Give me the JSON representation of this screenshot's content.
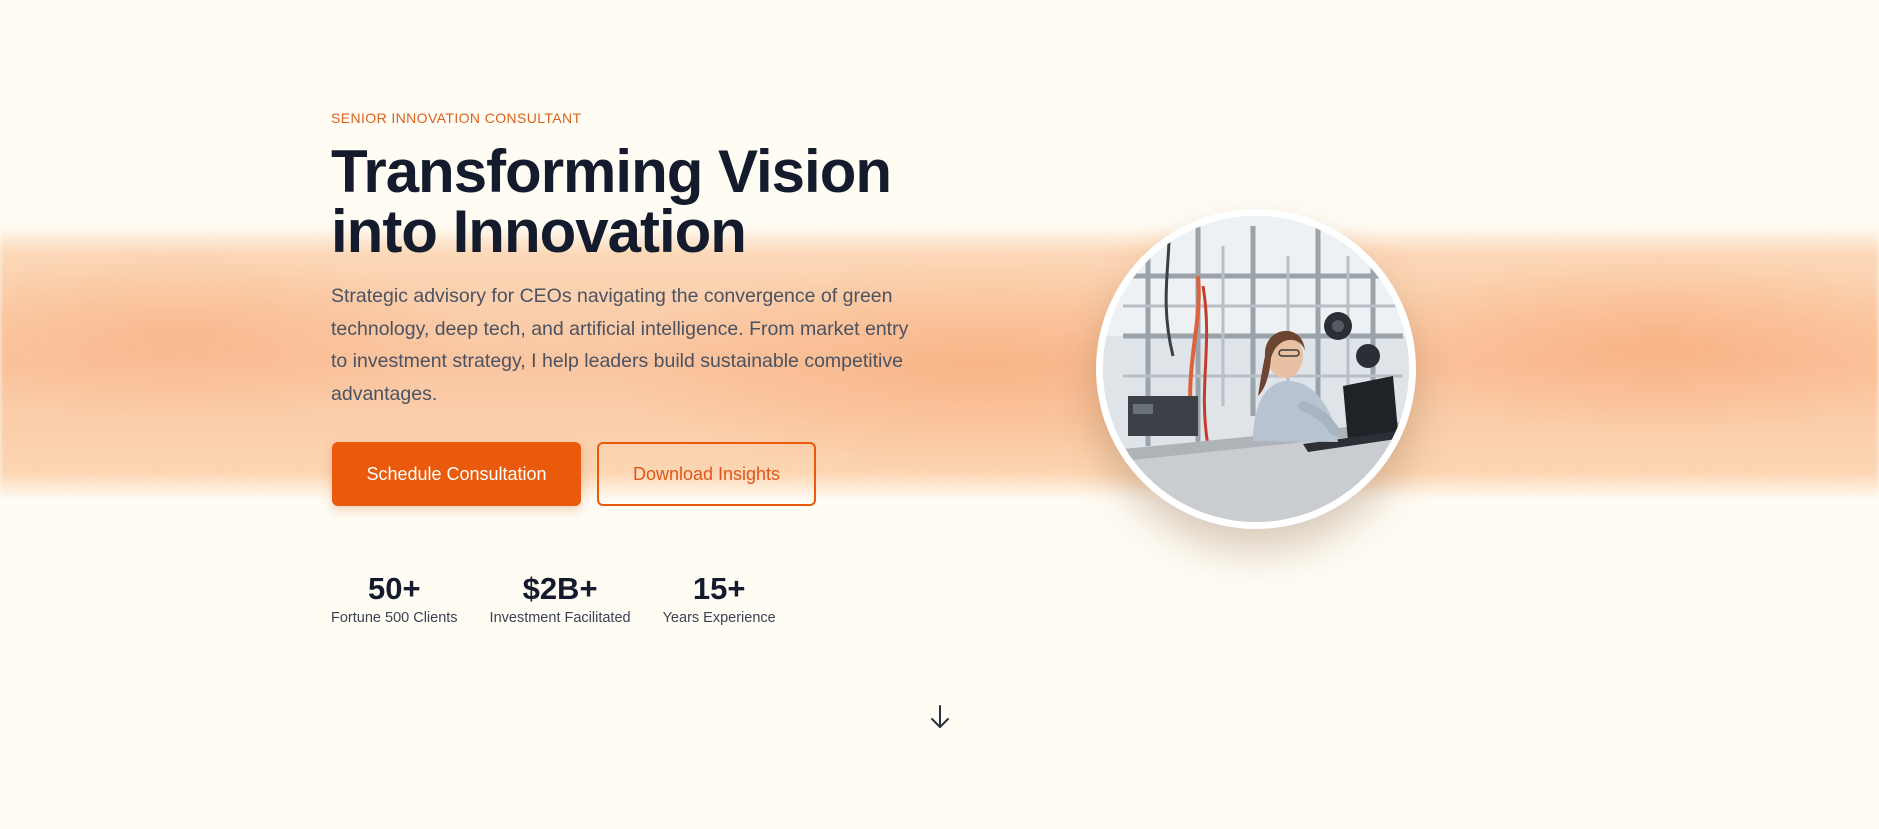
{
  "hero": {
    "eyebrow": "SENIOR INNOVATION CONSULTANT",
    "headline_line1": "Transforming Vision",
    "headline_line2": "into Innovation",
    "description": "Strategic advisory for CEOs navigating the convergence of green technology, deep tech, and artificial intelligence. From market entry to investment strategy, I help leaders build sustainable competitive advantages.",
    "primary_button": "Schedule Consultation",
    "secondary_button": "Download Insights",
    "stats": [
      {
        "value": "50+",
        "label": "Fortune 500 Clients"
      },
      {
        "value": "$2B+",
        "label": "Investment Facilitated"
      },
      {
        "value": "15+",
        "label": "Years Experience"
      }
    ]
  },
  "colors": {
    "accent": "#ea5a0c",
    "eyebrow": "#d9621f",
    "heading": "#141b2d",
    "body_text": "#4b5261",
    "background": "#fffcf4"
  },
  "icons": {
    "scroll": "arrow-down-icon"
  }
}
